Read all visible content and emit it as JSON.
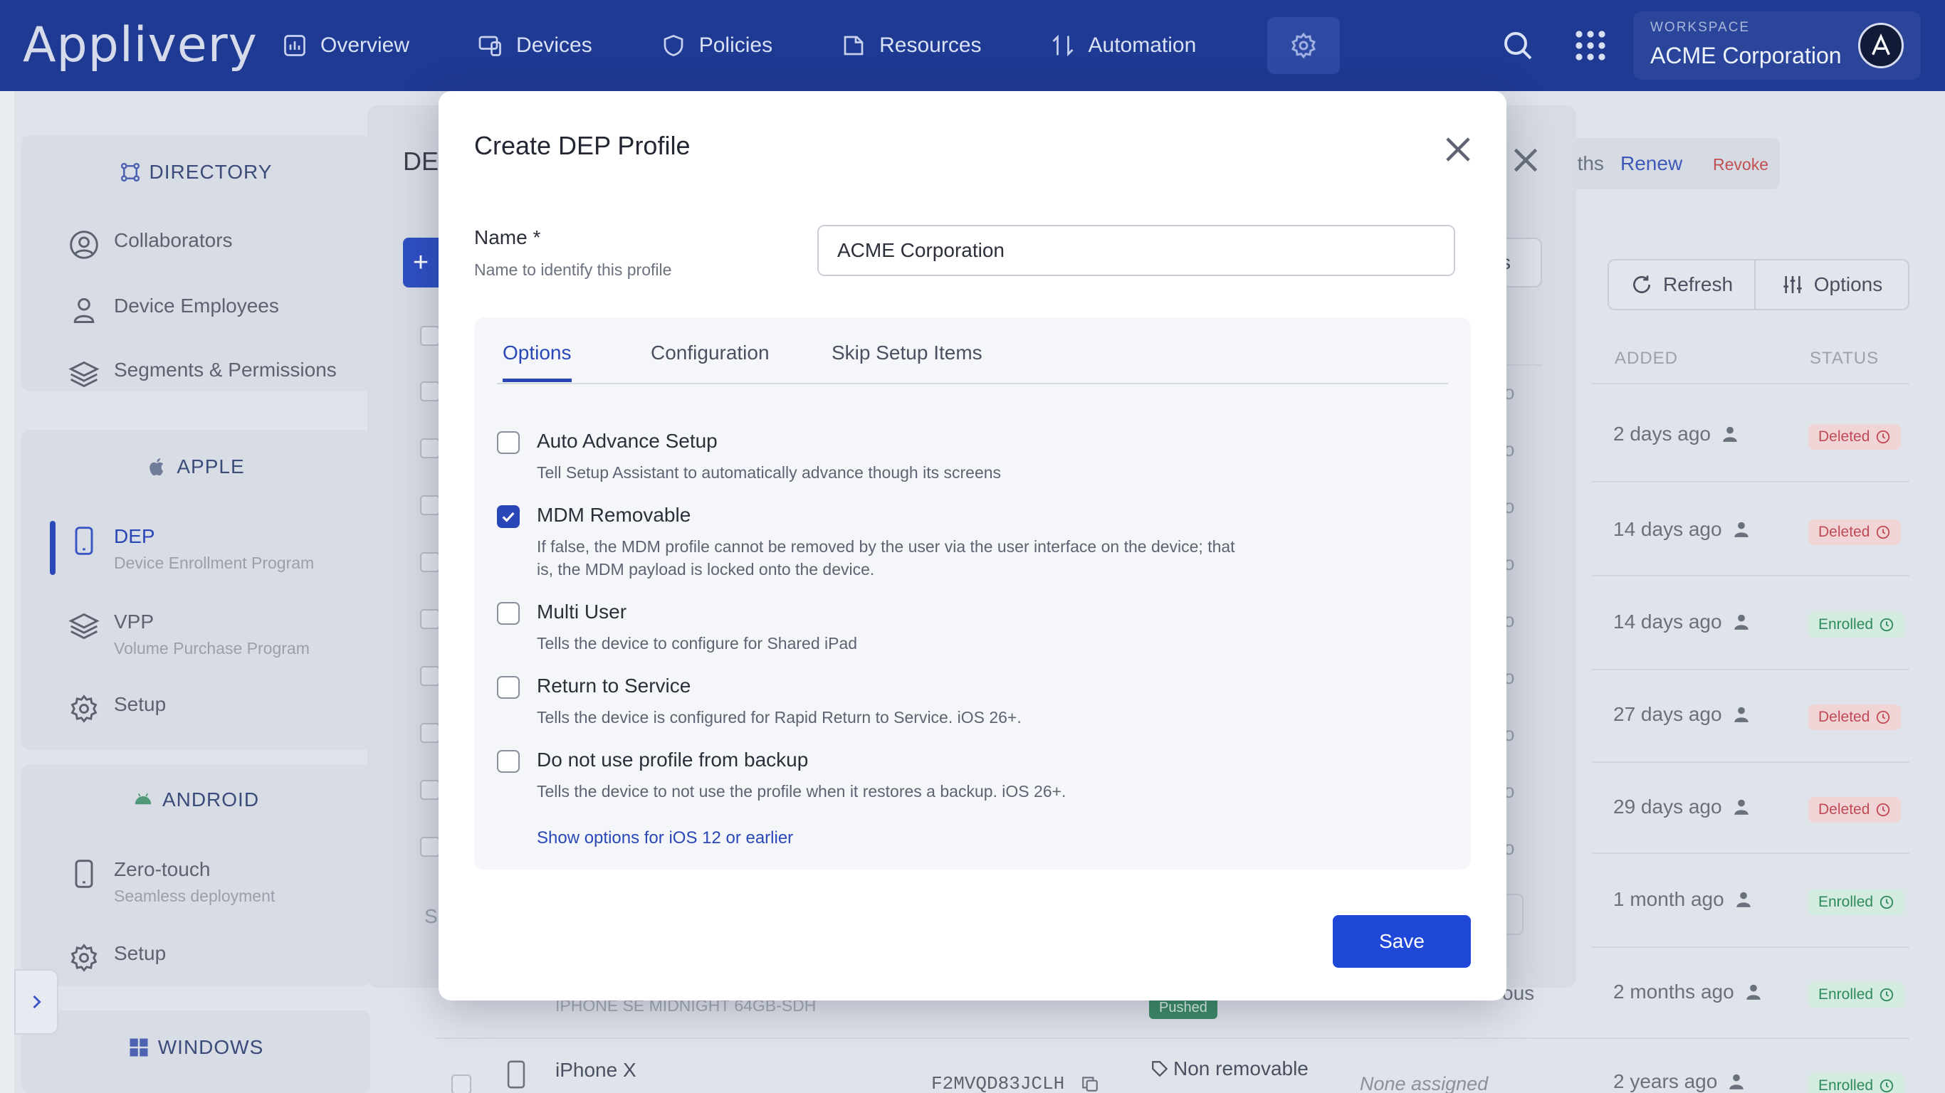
{
  "app": {
    "logo": "Applivery"
  },
  "nav": {
    "items": [
      {
        "label": "Overview",
        "icon": "chart-icon"
      },
      {
        "label": "Devices",
        "icon": "devices-icon"
      },
      {
        "label": "Policies",
        "icon": "shield-icon"
      },
      {
        "label": "Resources",
        "icon": "folder-icon"
      },
      {
        "label": "Automation",
        "icon": "automation-icon"
      }
    ]
  },
  "workspace": {
    "label": "WORKSPACE",
    "name": "ACME Corporation"
  },
  "sidebar": {
    "directory": {
      "heading": "DIRECTORY",
      "items": [
        {
          "label": "Collaborators"
        },
        {
          "label": "Device Employees"
        },
        {
          "label": "Segments & Permissions"
        }
      ]
    },
    "apple": {
      "heading": "APPLE",
      "items": [
        {
          "label": "DEP",
          "sub": "Device Enrollment Program"
        },
        {
          "label": "VPP",
          "sub": "Volume Purchase Program"
        },
        {
          "label": "Setup"
        }
      ]
    },
    "android": {
      "heading": "ANDROID",
      "items": [
        {
          "label": "Zero-touch",
          "sub": "Seamless deployment"
        },
        {
          "label": "Setup"
        }
      ]
    },
    "windows": {
      "heading": "WINDOWS"
    }
  },
  "background": {
    "drawer_title": "DE",
    "drawer_plus": "+",
    "drawer_s": "S",
    "drawer_pill_text": "s",
    "drawer_o": "o",
    "header_nths": "nths",
    "renew": "Renew",
    "revoke": "Revoke",
    "refresh": "Refresh",
    "options": "Options",
    "col_added": "ADDED",
    "col_status": "STATUS",
    "rows": [
      {
        "added": "2 days ago",
        "status": "Deleted"
      },
      {
        "added": "14 days ago",
        "status": "Deleted"
      },
      {
        "added": "14 days ago",
        "status": "Enrolled"
      },
      {
        "added": "27 days ago",
        "status": "Deleted"
      },
      {
        "added": "29 days ago",
        "status": "Deleted"
      },
      {
        "added": "1 month ago",
        "status": "Enrolled"
      },
      {
        "added": "2 months ago",
        "status": "Enrolled"
      },
      {
        "added": "2 years ago",
        "status": "Enrolled"
      }
    ],
    "device_sub": "IPHONE SE MIDNIGHT 64GB-SDH",
    "pushed": "Pushed",
    "ous": "ous",
    "device_name": "iPhone X",
    "serial": "F2MVQD83JCLH",
    "non_removable": "Non removable",
    "none_assigned": "None assigned"
  },
  "modal": {
    "title": "Create DEP Profile",
    "name_label": "Name *",
    "name_help": "Name to identify this profile",
    "name_value": "ACME Corporation",
    "tabs": [
      {
        "label": "Options",
        "active": true
      },
      {
        "label": "Configuration",
        "active": false
      },
      {
        "label": "Skip Setup Items",
        "active": false
      }
    ],
    "options": [
      {
        "title": "Auto Advance Setup",
        "desc": "Tell Setup Assistant to automatically advance though its screens",
        "checked": false
      },
      {
        "title": "MDM Removable",
        "desc": "If false, the MDM profile cannot be removed by the user via the user interface on the device; that is, the MDM payload is locked onto the device.",
        "checked": true
      },
      {
        "title": "Multi User",
        "desc": "Tells the device to configure for Shared iPad",
        "checked": false
      },
      {
        "title": "Return to Service",
        "desc": "Tells the device is configured for Rapid Return to Service. iOS 26+.",
        "checked": false
      },
      {
        "title": "Do not use profile from backup",
        "desc": "Tells the device to not use the profile when it restores a backup. iOS 26+.",
        "checked": false
      }
    ],
    "show_more": "Show options for iOS 12 or earlier",
    "save_label": "Save"
  },
  "colors": {
    "topbar": "#1f3a93",
    "accent": "#2a47b8",
    "save": "#1f48d8",
    "deleted": "#c04a55",
    "enrolled": "#2f8a5c"
  }
}
